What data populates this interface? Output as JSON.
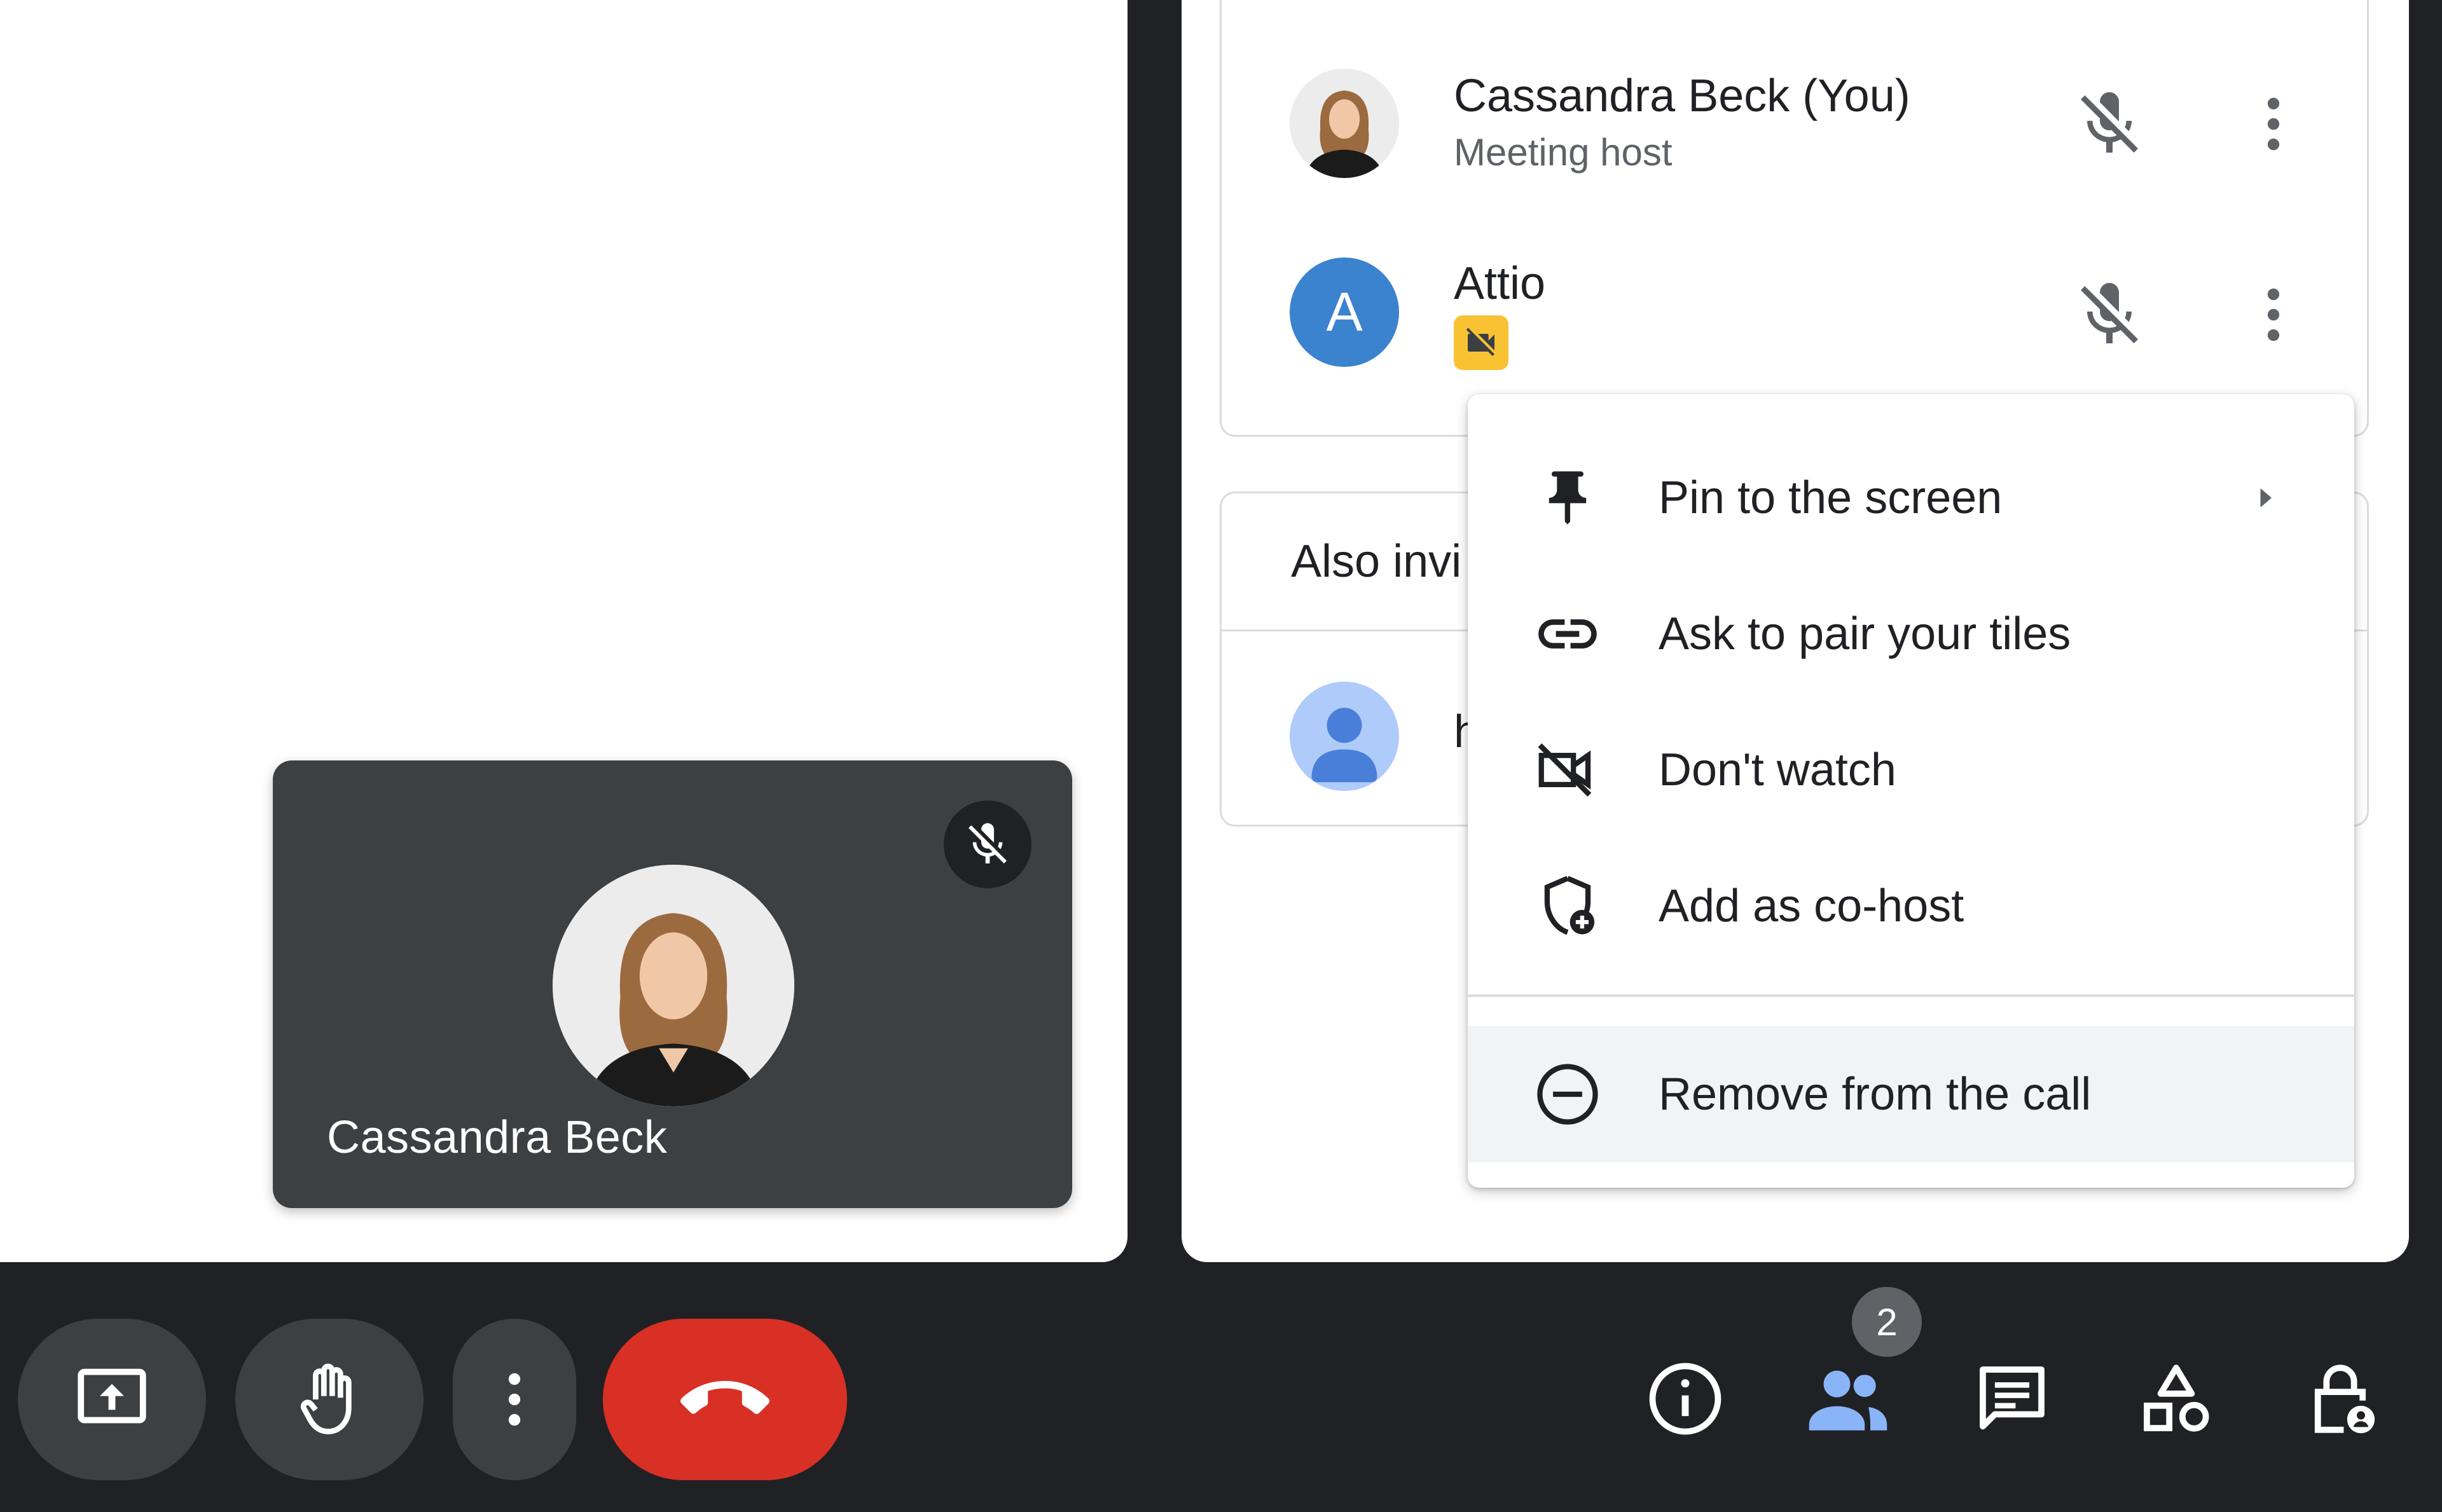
{
  "stage": {
    "self_tile": {
      "name": "Cassandra Beck",
      "mic_icon": "mic-off-icon"
    }
  },
  "people_panel": {
    "participants": [
      {
        "name": "Cassandra Beck (You)",
        "role": "Meeting host",
        "mic_icon": "mic-off-icon",
        "more_icon": "more-vert-icon"
      },
      {
        "name": "Attio",
        "avatar_letter": "A",
        "badge_icon": "video-off-badge-icon",
        "mic_icon": "mic-off-icon",
        "more_icon": "more-vert-icon"
      }
    ],
    "also_invited": {
      "title": "Also invi",
      "item_text": "h"
    }
  },
  "context_menu": {
    "items": [
      {
        "label": "Pin to the screen",
        "icon": "pin-icon",
        "submenu_icon": "arrow-right-icon"
      },
      {
        "label": "Ask to pair your tiles",
        "icon": "link-icon"
      },
      {
        "label": "Don't watch",
        "icon": "video-off-icon"
      },
      {
        "label": "Add as co-host",
        "icon": "shield-add-icon"
      },
      {
        "label": "Remove from the call",
        "icon": "remove-circle-icon"
      }
    ]
  },
  "bottom_bar": {
    "left": [
      "present-screen-icon",
      "raise-hand-icon",
      "more-vert-icon",
      "hang-up-icon"
    ],
    "right": [
      "info-icon",
      "people-icon",
      "chat-icon",
      "activities-icon",
      "host-controls-icon"
    ],
    "people_count": "2"
  },
  "colors": {
    "background": "#202124",
    "panel": "#ffffff",
    "tile": "#3c4043",
    "hang_up": "#d93025",
    "people_active": "#8ab4f8",
    "avatar_a": "#3b82cf",
    "badge": "#f9c233"
  }
}
